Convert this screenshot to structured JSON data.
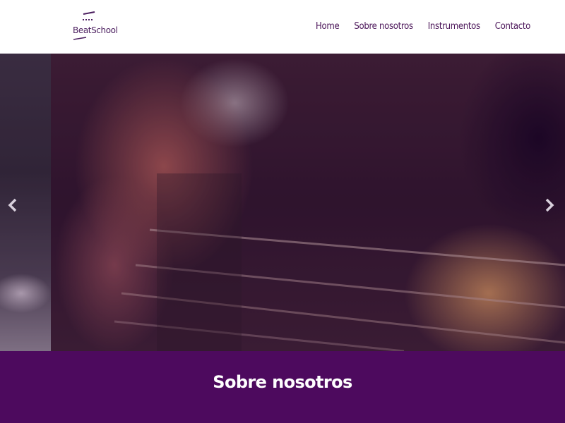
{
  "header": {
    "logo_text": "BeatSchool",
    "nav": {
      "home": "Home",
      "sobre": "Sobre nosotros",
      "instrumentos": "Instrumentos",
      "contacto": "Contacto"
    }
  },
  "carousel": {
    "prev_icon": "chevron-left-icon",
    "next_icon": "chevron-right-icon",
    "image_description": "close-up of a hand playing bass guitar strings"
  },
  "about": {
    "title": "Sobre nosotros"
  },
  "colors": {
    "brand_purple": "#4d0a5e",
    "nav_text": "#4a1458",
    "white": "#ffffff"
  }
}
